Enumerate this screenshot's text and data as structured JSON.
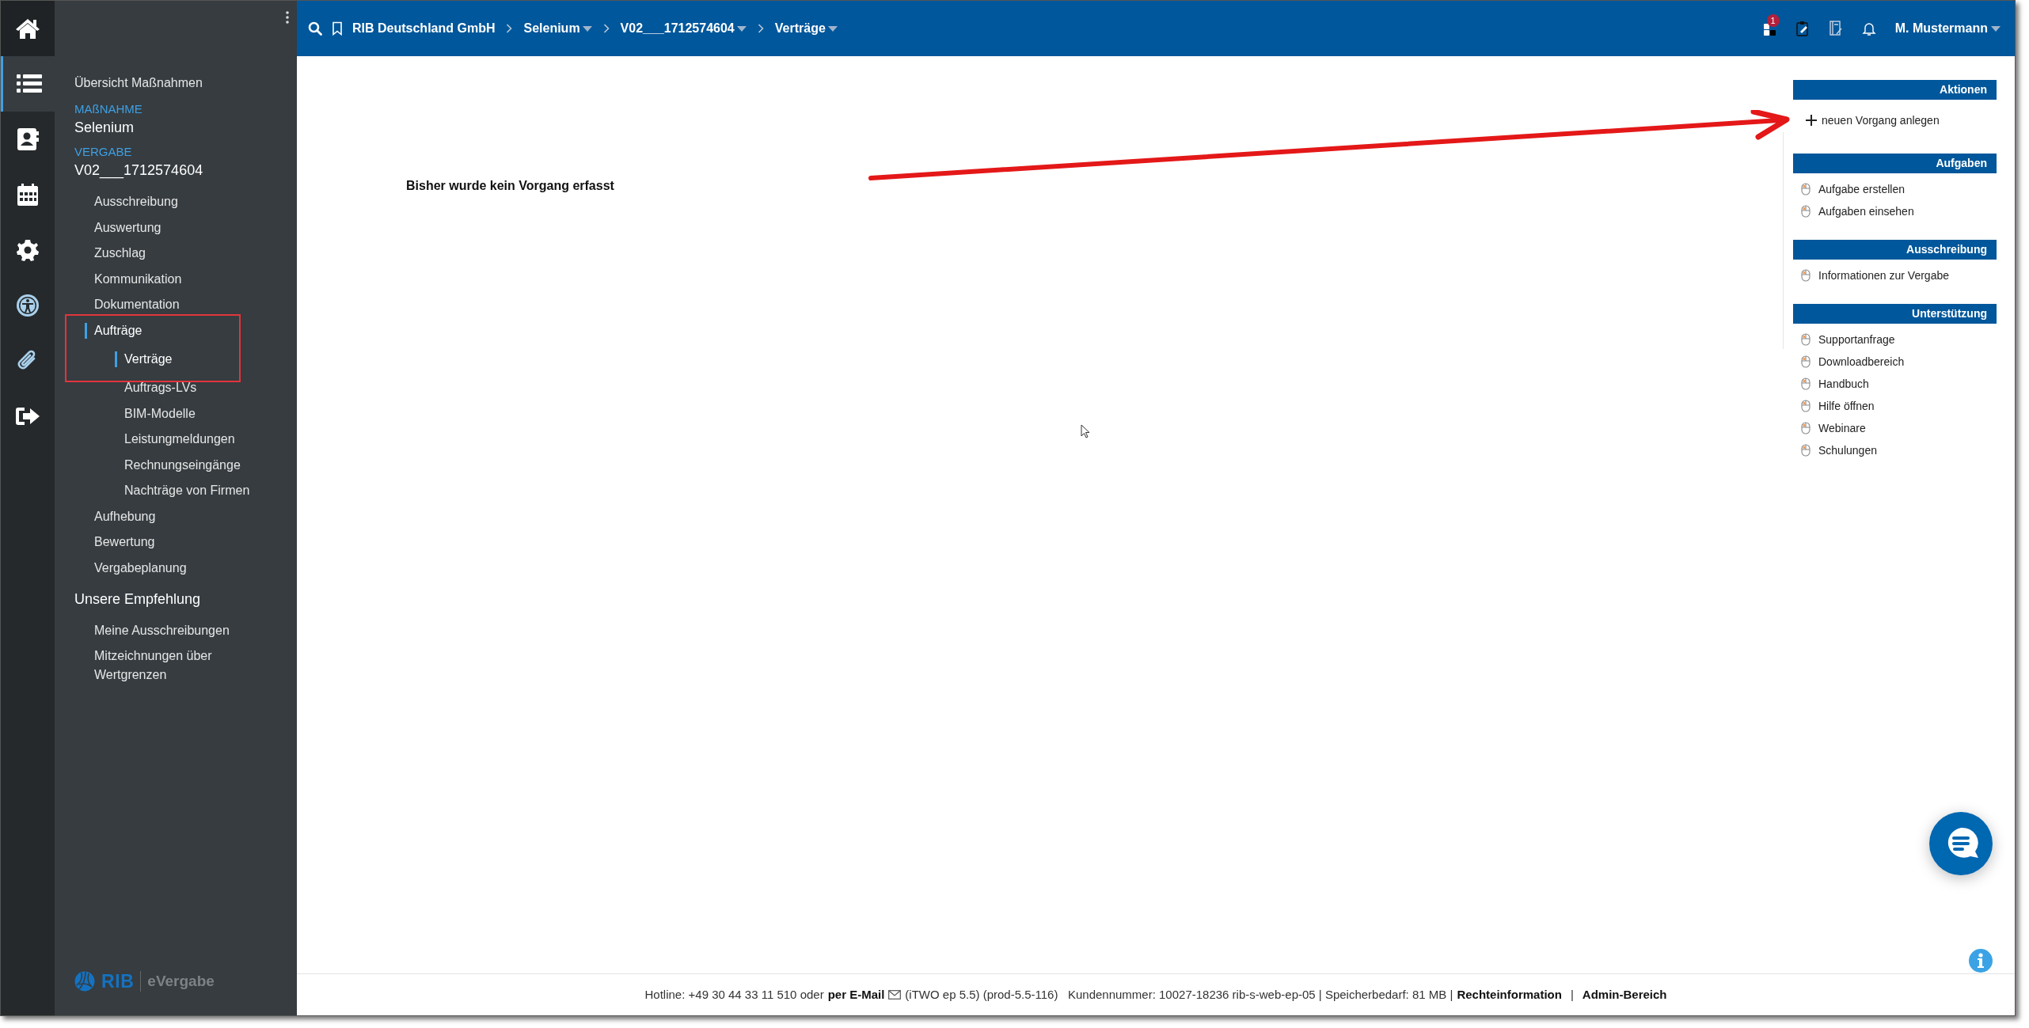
{
  "rail": [
    {
      "selected": false
    },
    {
      "selected": true
    },
    {
      "selected": false
    },
    {
      "selected": false
    },
    {
      "selected": false
    },
    {
      "selected": false
    },
    {
      "selected": false
    },
    {
      "selected": false
    }
  ],
  "sidebar": {
    "overview": "Übersicht Maßnahmen",
    "context": [
      {
        "label": "MAßNAHME",
        "value": "Selenium"
      },
      {
        "label": "VERGABE",
        "value": "V02___1712574604"
      }
    ],
    "menu": [
      {
        "label": "Ausschreibung",
        "selected": false
      },
      {
        "label": "Auswertung",
        "selected": false
      },
      {
        "label": "Zuschlag",
        "selected": false
      },
      {
        "label": "Kommunikation",
        "selected": false
      },
      {
        "label": "Dokumentation",
        "selected": false
      },
      {
        "label": "Aufträge",
        "selected": true,
        "children": [
          {
            "label": "Verträge",
            "selected": true
          },
          {
            "label": "Auftrags-LVs",
            "selected": false
          },
          {
            "label": "BIM-Modelle",
            "selected": false
          },
          {
            "label": "Leistungmeldungen",
            "selected": false
          },
          {
            "label": "Rechnungseingänge",
            "selected": false
          },
          {
            "label": "Nachträge von Firmen",
            "selected": false
          }
        ]
      },
      {
        "label": "Aufhebung",
        "selected": false
      },
      {
        "label": "Bewertung",
        "selected": false
      },
      {
        "label": "Vergabeplanung",
        "selected": false
      }
    ],
    "recommendation": {
      "title": "Unsere Empfehlung",
      "items": [
        "Meine Ausschreibungen",
        "Mitzeichnungen über Wertgrenzen"
      ]
    },
    "logo": {
      "brand": "RIB",
      "product": "eVergabe"
    }
  },
  "breadcrumb": [
    {
      "label": "RIB Deutschland GmbH",
      "dropdown": false
    },
    {
      "label": "Selenium",
      "dropdown": true
    },
    {
      "label": "V02___1712574604",
      "dropdown": true
    },
    {
      "label": "Verträge",
      "dropdown": true
    }
  ],
  "top_bar": {
    "badge": "1",
    "user": "M. Mustermann"
  },
  "content": {
    "empty_message": "Bisher wurde kein Vorgang erfasst"
  },
  "side_panel": [
    {
      "title": "Aktionen",
      "items": [
        {
          "label": "neuen Vorgang anlegen",
          "kind": "add"
        }
      ]
    },
    {
      "title": "Aufgaben",
      "items": [
        {
          "label": "Aufgabe erstellen",
          "kind": "link"
        },
        {
          "label": "Aufgaben einsehen",
          "kind": "link"
        }
      ]
    },
    {
      "title": "Ausschreibung",
      "items": [
        {
          "label": "Informationen zur Vergabe",
          "kind": "link"
        }
      ]
    },
    {
      "title": "Unterstützung",
      "items": [
        {
          "label": "Supportanfrage",
          "kind": "link"
        },
        {
          "label": "Downloadbereich",
          "kind": "link"
        },
        {
          "label": "Handbuch",
          "kind": "link"
        },
        {
          "label": "Hilfe öffnen",
          "kind": "link"
        },
        {
          "label": "Webinare",
          "kind": "link"
        },
        {
          "label": "Schulungen",
          "kind": "link"
        }
      ]
    }
  ],
  "footer": {
    "hotline": "Hotline: +49 30 44 33 11 510 oder",
    "email_link": "per E-Mail",
    "info": "(iTWO ep 5.5) (prod-5.5-116)   Kundennummer: 10027-18236 rib-s-web-ep-05 | Speicherbedarf: 81 MB |",
    "links": [
      "Rechteinformation",
      "Admin-Bereich"
    ],
    "separator": "|"
  }
}
